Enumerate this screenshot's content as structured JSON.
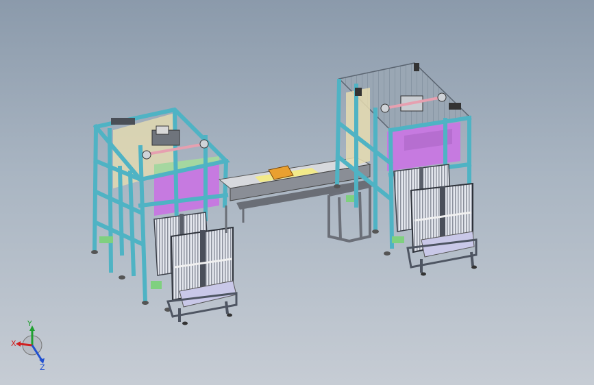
{
  "view": {
    "background_top": "#8b9aab",
    "background_bottom": "#c6ccd4"
  },
  "model": {
    "frame_color": "#4fb3c4",
    "panel_color": "#c67ae0",
    "rail_color": "#8a8e96",
    "carriage_color": "#e9a030",
    "cell_color": "#d9dde6",
    "tray_color": "#c9c8e8"
  },
  "triad": {
    "x_label": "X",
    "y_label": "Y",
    "z_label": "Z",
    "x_color": "#d02020",
    "y_color": "#20a030",
    "z_color": "#2050d0"
  }
}
